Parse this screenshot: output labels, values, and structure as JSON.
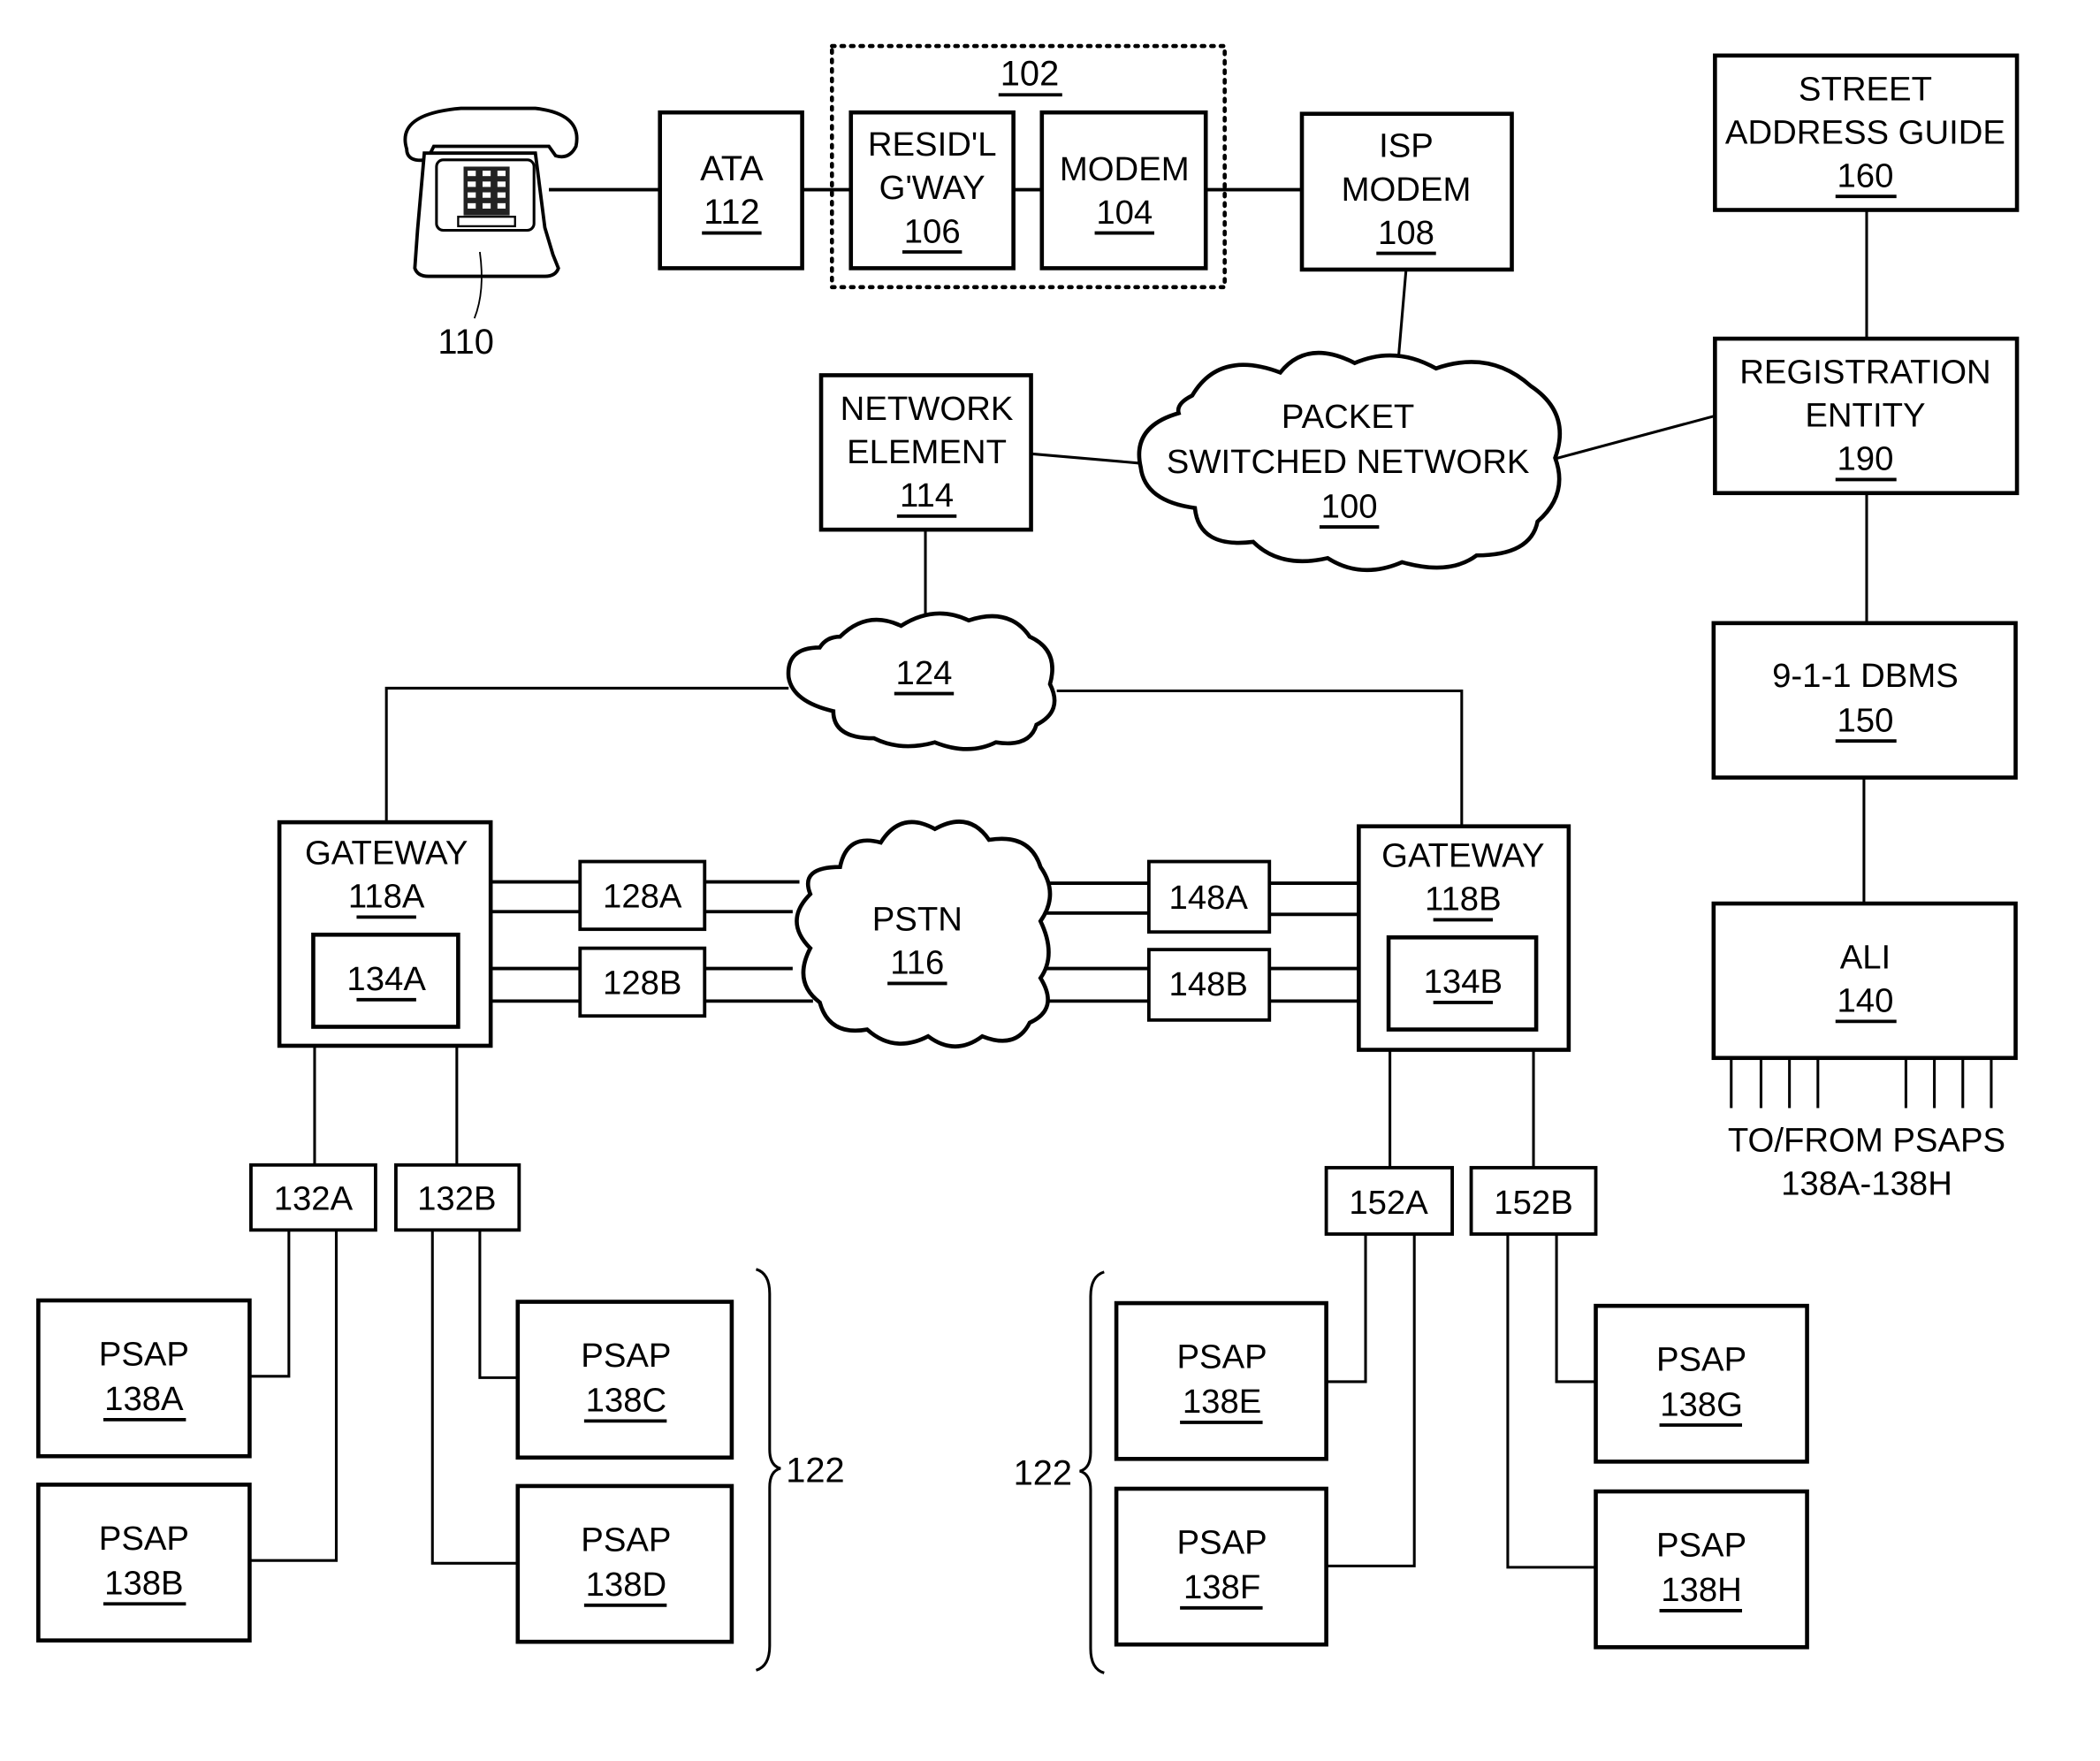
{
  "figure": {
    "phone": {
      "ref": "110"
    },
    "ata": {
      "line1": "ATA",
      "ref": "112"
    },
    "residential_unit": {
      "ref": "102"
    },
    "resid_gateway": {
      "line1": "RESID'L",
      "line2": "G'WAY",
      "ref": "106"
    },
    "modem": {
      "line1": "MODEM",
      "ref": "104"
    },
    "isp_modem": {
      "line1": "ISP",
      "line2": "MODEM",
      "ref": "108"
    },
    "street_address_guide": {
      "line1": "STREET",
      "line2": "ADDRESS GUIDE",
      "ref": "160"
    },
    "registration_entity": {
      "line1": "REGISTRATION",
      "line2": "ENTITY",
      "ref": "190"
    },
    "network_element": {
      "line1": "NETWORK",
      "line2": "ELEMENT",
      "ref": "114"
    },
    "packet_switched_network": {
      "line1": "PACKET",
      "line2": "SWITCHED NETWORK",
      "ref": "100"
    },
    "network_124": {
      "ref": "124"
    },
    "dbms": {
      "line1": "9-1-1 DBMS",
      "ref": "150"
    },
    "ali": {
      "line1": "ALI",
      "ref": "140"
    },
    "ali_note": {
      "line1": "TO/FROM PSAPS",
      "line2": "138A-138H"
    },
    "gateway_a": {
      "line1": "GATEWAY",
      "ref": "118A",
      "inner": "134A"
    },
    "gateway_b": {
      "line1": "GATEWAY",
      "ref": "118B",
      "inner": "134B"
    },
    "pstn": {
      "line1": "PSTN",
      "ref": "116"
    },
    "trunks": {
      "t128a": "128A",
      "t128b": "128B",
      "t148a": "148A",
      "t148b": "148B"
    },
    "selective_routers": {
      "r132a": "132A",
      "r132b": "132B",
      "r152a": "152A",
      "r152b": "152B"
    },
    "psaps": [
      {
        "line1": "PSAP",
        "ref": "138A"
      },
      {
        "line1": "PSAP",
        "ref": "138B"
      },
      {
        "line1": "PSAP",
        "ref": "138C"
      },
      {
        "line1": "PSAP",
        "ref": "138D"
      },
      {
        "line1": "PSAP",
        "ref": "138E"
      },
      {
        "line1": "PSAP",
        "ref": "138F"
      },
      {
        "line1": "PSAP",
        "ref": "138G"
      },
      {
        "line1": "PSAP",
        "ref": "138H"
      }
    ],
    "psap_group_left": {
      "ref": "122"
    },
    "psap_group_right": {
      "ref": "122"
    }
  }
}
